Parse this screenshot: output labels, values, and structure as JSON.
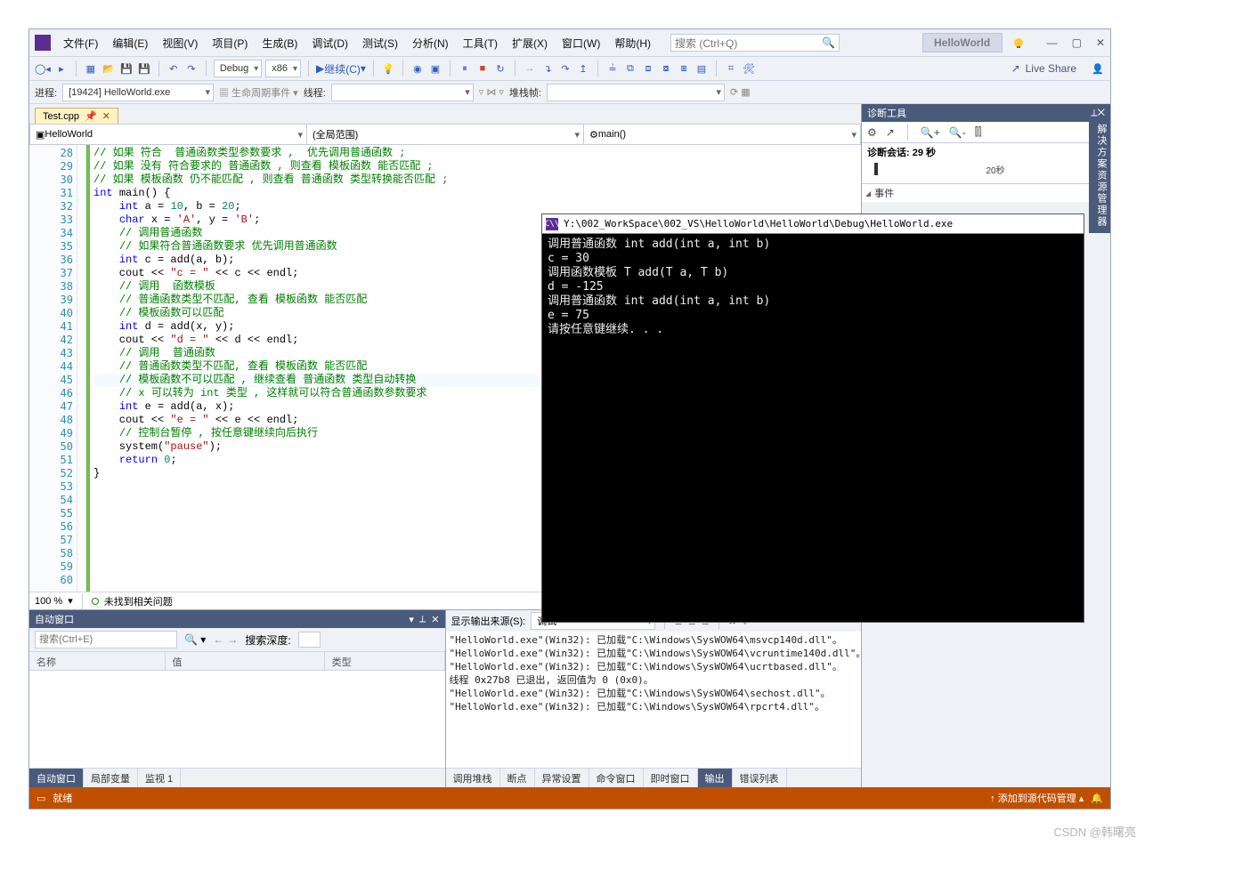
{
  "menubar": [
    "文件(F)",
    "编辑(E)",
    "视图(V)",
    "项目(P)",
    "生成(B)",
    "调试(D)",
    "测试(S)",
    "分析(N)",
    "工具(T)",
    "扩展(X)",
    "窗口(W)",
    "帮助(H)"
  ],
  "search_placeholder": "搜索 (Ctrl+Q)",
  "solution_btn": "HelloWorld",
  "live_share": "Live Share",
  "toolbar": {
    "config": "Debug",
    "platform": "x86",
    "run": "继续(C)"
  },
  "debugbar": {
    "process_lbl": "进程:",
    "process": "[19424] HelloWorld.exe",
    "lifecycle": "生命周期事件",
    "thread_lbl": "线程:",
    "stack_lbl": "堆栈帧:"
  },
  "tab": "Test.cpp",
  "contexts": {
    "project": "HelloWorld",
    "scope": "(全局范围)",
    "func": "main()"
  },
  "lines_start": 28,
  "code": [
    [
      [
        "cm",
        "// 如果 符合  普通函数类型参数要求 ,  优先调用普通函数 ;"
      ]
    ],
    [
      [
        "cm",
        "// 如果 没有 符合要求的 普通函数 , 则查看 模板函数 能否匹配 ;"
      ]
    ],
    [
      [
        "cm",
        "// 如果 模板函数 仍不能匹配 , 则查看 普通函数 类型转换能否匹配 ;"
      ]
    ],
    [
      [
        "",
        ""
      ]
    ],
    [
      [
        "kw",
        "int"
      ],
      [
        "",
        " "
      ],
      [
        "fn",
        "main"
      ],
      [
        "",
        "() {"
      ]
    ],
    [
      [
        "",
        ""
      ]
    ],
    [
      [
        "",
        "    "
      ],
      [
        "kw",
        "int"
      ],
      [
        "",
        " a = "
      ],
      [
        "nm",
        "10"
      ],
      [
        "",
        ", b = "
      ],
      [
        "nm",
        "20"
      ],
      [
        "",
        ";"
      ]
    ],
    [
      [
        "",
        "    "
      ],
      [
        "kw",
        "char"
      ],
      [
        "",
        " x = "
      ],
      [
        "st",
        "'A'"
      ],
      [
        "",
        ", y = "
      ],
      [
        "st",
        "'B'"
      ],
      [
        "",
        ";"
      ]
    ],
    [
      [
        "",
        ""
      ]
    ],
    [
      [
        "",
        "    "
      ],
      [
        "cm",
        "// 调用普通函数"
      ]
    ],
    [
      [
        "",
        "    "
      ],
      [
        "cm",
        "// 如果符合普通函数要求 优先调用普通函数"
      ]
    ],
    [
      [
        "",
        "    "
      ],
      [
        "kw",
        "int"
      ],
      [
        "",
        " c = add(a, b);"
      ]
    ],
    [
      [
        "",
        "    cout << "
      ],
      [
        "st",
        "\"c = \""
      ],
      [
        "",
        " << c << endl;"
      ]
    ],
    [
      [
        "",
        ""
      ]
    ],
    [
      [
        "",
        "    "
      ],
      [
        "cm",
        "// 调用  函数模板"
      ]
    ],
    [
      [
        "",
        "    "
      ],
      [
        "cm",
        "// 普通函数类型不匹配, 查看 模板函数 能否匹配"
      ]
    ],
    [
      [
        "",
        "    "
      ],
      [
        "cm",
        "// 模板函数可以匹配"
      ]
    ],
    [
      [
        "",
        "    "
      ],
      [
        "kw",
        "int"
      ],
      [
        "",
        " d = add(x, y);"
      ]
    ],
    [
      [
        "",
        "    cout << "
      ],
      [
        "st",
        "\"d = \""
      ],
      [
        "",
        " << d << endl;"
      ]
    ],
    [
      [
        "",
        ""
      ]
    ],
    [
      [
        "",
        "    "
      ],
      [
        "cm",
        "// 调用  普通函数"
      ]
    ],
    [
      [
        "",
        "    "
      ],
      [
        "cm",
        "// 普通函数类型不匹配, 查看 模板函数 能否匹配"
      ]
    ],
    [
      [
        "",
        "    "
      ],
      [
        "cm",
        "// 模板函数不可以匹配 , 继续查看 普通函数 类型自动转换"
      ]
    ],
    [
      [
        "",
        "    "
      ],
      [
        "cm",
        "// x 可以转为 int 类型 , 这样就可以符合普通函数参数要求"
      ]
    ],
    [
      [
        "",
        "    "
      ],
      [
        "kw",
        "int"
      ],
      [
        "",
        " e = add(a, x);"
      ]
    ],
    [
      [
        "",
        "    cout << "
      ],
      [
        "st",
        "\"e = \""
      ],
      [
        "",
        " << e << endl;"
      ]
    ],
    [
      [
        "",
        ""
      ]
    ],
    [
      [
        "",
        "    "
      ],
      [
        "cm",
        "// 控制台暂停 , 按任意键继续向后执行"
      ]
    ],
    [
      [
        "",
        "    system("
      ],
      [
        "st",
        "\"pause\""
      ],
      [
        "",
        ");"
      ]
    ],
    [
      [
        "",
        ""
      ]
    ],
    [
      [
        "",
        "    "
      ],
      [
        "kw",
        "return"
      ],
      [
        "",
        " "
      ],
      [
        "nm",
        "0"
      ],
      [
        "",
        ";"
      ]
    ],
    [
      [
        "",
        "}"
      ]
    ],
    [
      [
        "",
        ""
      ]
    ]
  ],
  "highlight_line": 50,
  "zoom": "100 %",
  "issues_msg": "未找到相关问题",
  "autos_pane": {
    "title": "自动窗口",
    "search": "搜索(Ctrl+E)",
    "depth_lbl": "搜索深度:",
    "cols": [
      "名称",
      "值",
      "类型"
    ],
    "tabs": [
      "自动窗口",
      "局部变量",
      "监视 1"
    ],
    "active_tab": 0
  },
  "output_pane": {
    "src_lbl": "显示输出来源(S):",
    "src": "调试",
    "lines": [
      "\"HelloWorld.exe\"(Win32): 已加载\"C:\\Windows\\SysWOW64\\msvcp140d.dll\"。",
      "\"HelloWorld.exe\"(Win32): 已加载\"C:\\Windows\\SysWOW64\\vcruntime140d.dll\"。",
      "\"HelloWorld.exe\"(Win32): 已加载\"C:\\Windows\\SysWOW64\\ucrtbased.dll\"。",
      "线程 0x27b8 已退出, 返回值为 0 (0x0)。",
      "\"HelloWorld.exe\"(Win32): 已加载\"C:\\Windows\\SysWOW64\\sechost.dll\"。",
      "\"HelloWorld.exe\"(Win32): 已加载\"C:\\Windows\\SysWOW64\\rpcrt4.dll\"。"
    ],
    "tabs": [
      "调用堆栈",
      "断点",
      "异常设置",
      "命令窗口",
      "即时窗口",
      "输出",
      "错误列表"
    ],
    "active_tab": 5
  },
  "diag": {
    "title": "诊断工具",
    "session": "诊断会话: 29 秒",
    "tick": "20秒",
    "section": "事件"
  },
  "side_tab": "解决方案资源管理器",
  "console": {
    "title": "Y:\\002_WorkSpace\\002_VS\\HelloWorld\\HelloWorld\\Debug\\HelloWorld.exe",
    "body": "调用普通函数 int add(int a, int b)\nc = 30\n调用函数模板 T add(T a, T b)\nd = -125\n调用普通函数 int add(int a, int b)\ne = 75\n请按任意键继续. . ."
  },
  "status": {
    "state": "就绪",
    "scm": "添加到源代码管理"
  },
  "watermark": "CSDN @韩曙亮"
}
